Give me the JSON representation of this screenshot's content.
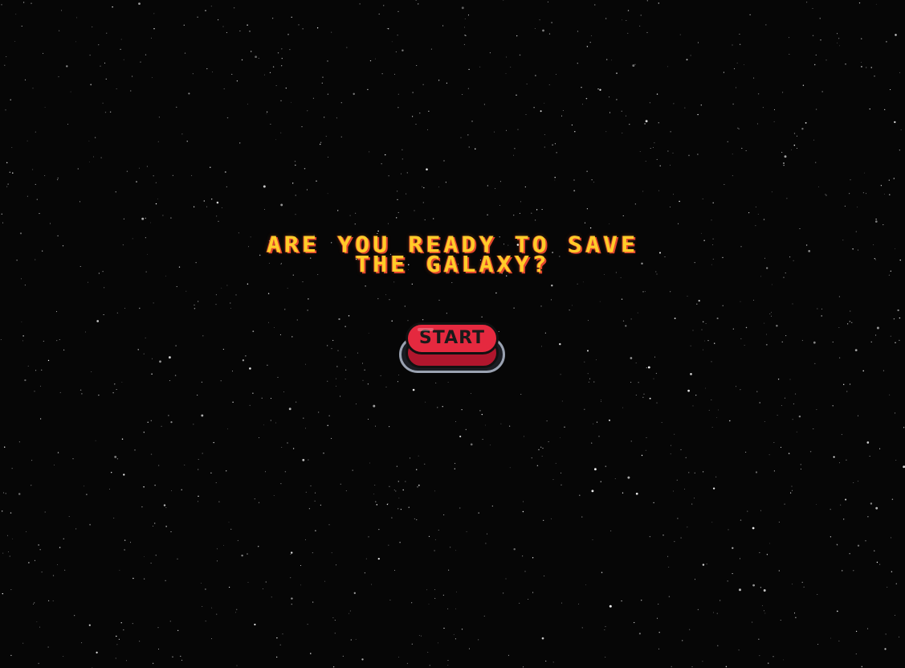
{
  "headline": {
    "line1": "ARE YOU READY TO SAVE",
    "line2": "THE GALAXY?"
  },
  "start_button": {
    "label": "START"
  },
  "colors": {
    "background": "#060606",
    "headline_fill": "#ffcc29",
    "headline_shadow": "#e4462e",
    "button_red": "#e5293f",
    "button_rim": "#9aa2b1",
    "star": "#ffffff"
  }
}
